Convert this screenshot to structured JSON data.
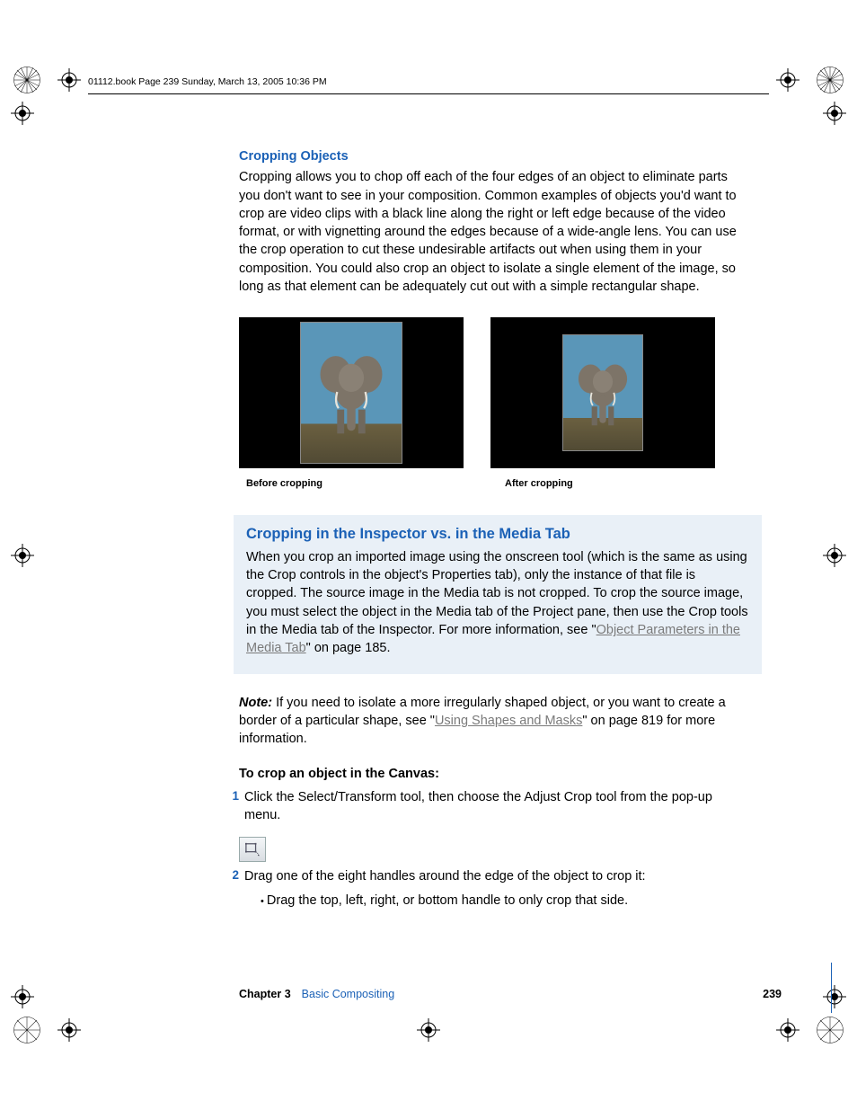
{
  "header": {
    "runner": "01112.book  Page 239  Sunday, March 13, 2005  10:36 PM"
  },
  "section": {
    "heading": "Cropping Objects",
    "body": "Cropping allows you to chop off each of the four edges of an object to eliminate parts you don't want to see in your composition. Common examples of objects you'd want to crop are video clips with a black line along the right or left edge because of the video format, or with vignetting around the edges because of a wide-angle lens. You can use the crop operation to cut these undesirable artifacts out when using them in your composition. You could also crop an object to isolate a single element of the image, so long as that element can be adequately cut out with a simple rectangular shape."
  },
  "captions": {
    "before": "Before cropping",
    "after": "After cropping"
  },
  "callout": {
    "title": "Cropping in the Inspector vs. in the Media Tab",
    "body_a": "When you crop an imported image using the onscreen tool (which is the same as using the Crop controls in the object's Properties tab), only the instance of that file is cropped. The source image in the Media tab is not cropped. To crop the source image, you must select the object in the Media tab of the Project pane, then use the Crop tools in the Media tab of the Inspector. For more information, see \"",
    "link": "Object Parameters in the Media Tab",
    "body_b": "\" on page 185."
  },
  "note": {
    "label": "Note:  ",
    "body_a": "If you need to isolate a more irregularly shaped object, or you want to create a border of a particular shape, see \"",
    "link": "Using Shapes and Masks",
    "body_b": "\" on page 819 for more information."
  },
  "steps": {
    "title": "To crop an object in the Canvas:",
    "s1_num": "1",
    "s1": "Click the Select/Transform tool, then choose the Adjust Crop tool from the pop-up menu.",
    "s2_num": "2",
    "s2": "Drag one of the eight handles around the edge of the object to crop it:",
    "bullet": "Drag the top, left, right, or bottom handle to only crop that side."
  },
  "footer": {
    "chapter": "Chapter 3",
    "title": "Basic Compositing",
    "page": "239"
  }
}
